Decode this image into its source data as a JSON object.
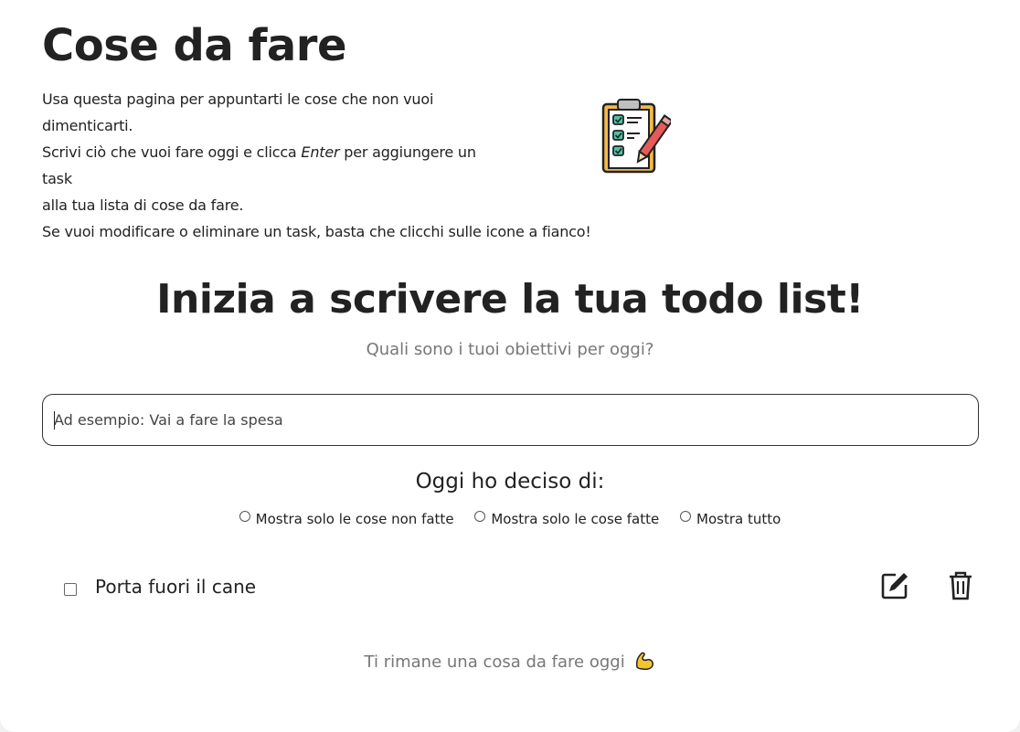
{
  "header": {
    "title": "Cose da fare",
    "intro_line1": "Usa questa pagina per appuntarti le cose che non vuoi",
    "intro_line2": "dimenticarti.",
    "intro_line3_a": "Scrivi ciò che vuoi fare oggi e clicca ",
    "intro_line3_em": "Enter",
    "intro_line3_b": " per aggiungere un",
    "intro_line4": "task",
    "intro_line5": "alla tua lista di cose da fare.",
    "intro_line6": "Se vuoi modificare o eliminare un task, basta che clicchi sulle icone a fianco!",
    "illustration_icon": "clipboard-checklist-icon"
  },
  "main": {
    "subtitle": "Inizia a scrivere la tua todo list!",
    "question": "Quali sono i tuoi obiettivi per oggi?",
    "input_placeholder": "Ad esempio: Vai a fare la spesa",
    "input_value": ""
  },
  "filters": {
    "title": "Oggi ho deciso di:",
    "options": [
      {
        "label": "Mostra solo le cose non fatte",
        "selected": false
      },
      {
        "label": "Mostra solo le cose fatte",
        "selected": false
      },
      {
        "label": "Mostra tutto",
        "selected": false
      }
    ]
  },
  "tasks": [
    {
      "label": "Porta fuori il cane",
      "done": false,
      "edit_icon": "edit-icon",
      "delete_icon": "trash-icon"
    }
  ],
  "footer": {
    "remaining_text": "Ti rimane una cosa da fare oggi",
    "remaining_icon": "flexed-biceps-icon"
  },
  "colors": {
    "text": "#222222",
    "muted": "#777777",
    "background": "#ffffff",
    "clipboard_board": "#f2b94a",
    "check_teal": "#4cc3a3"
  }
}
